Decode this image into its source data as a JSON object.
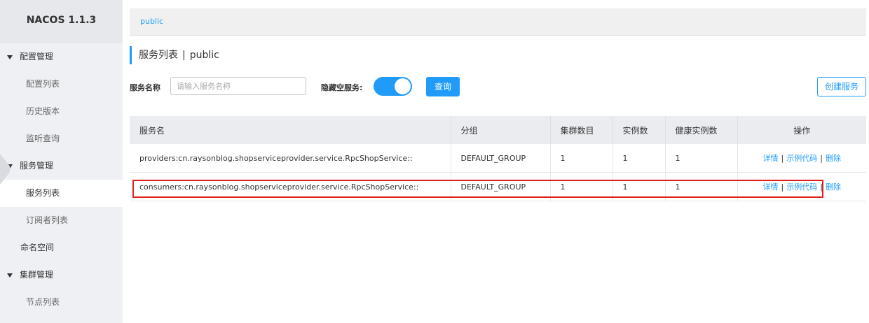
{
  "sidebar": {
    "brand": "NACOS 1.1.3",
    "groups": [
      {
        "label": "配置管理",
        "items": [
          "配置列表",
          "历史版本",
          "监听查询"
        ]
      },
      {
        "label": "服务管理",
        "items": [
          "服务列表",
          "订阅者列表"
        ]
      }
    ],
    "namespace": "命名空间",
    "cluster_group": "集群管理",
    "cluster_items": [
      "节点列表"
    ]
  },
  "crumb": "public",
  "page": {
    "title": "服务列表",
    "sep": "|",
    "namespace": "public"
  },
  "filter": {
    "name_label": "服务名称",
    "name_placeholder": "请输入服务名称",
    "hide_empty_label": "隐藏空服务:",
    "query_label": "查询",
    "create_label": "创建服务"
  },
  "table": {
    "headers": [
      "服务名",
      "分组",
      "集群数目",
      "实例数",
      "健康实例数",
      "操作"
    ],
    "rows": [
      {
        "name": "providers:cn.raysonblog.shopserviceprovider.service.RpcShopService::",
        "group": "DEFAULT_GROUP",
        "clusters": "1",
        "instances": "1",
        "healthy": "1"
      },
      {
        "name": "consumers:cn.raysonblog.shopserviceprovider.service.RpcShopService::",
        "group": "DEFAULT_GROUP",
        "clusters": "1",
        "instances": "1",
        "healthy": "1"
      }
    ],
    "ops": {
      "detail": "详情",
      "sample": "示例代码",
      "delete": "删除",
      "sep": "|"
    }
  },
  "colors": {
    "accent": "#209bfa",
    "highlight": "#e02020"
  }
}
